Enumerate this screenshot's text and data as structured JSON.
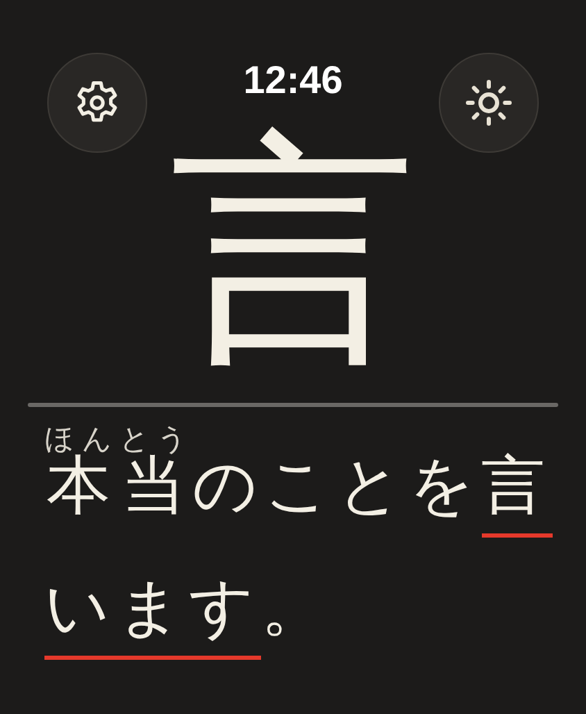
{
  "status_bar": {
    "time": "12:46"
  },
  "buttons": [
    {
      "kind": "settings"
    },
    {
      "kind": "brightness"
    }
  ],
  "kanji": "言",
  "sentence": [
    {
      "text": "本当",
      "ruby": "ほんとう",
      "highlighted": false
    },
    {
      "text": "のことを",
      "highlighted": false
    },
    {
      "text": "言います",
      "highlighted": true
    },
    {
      "text": "。",
      "highlighted": false
    }
  ]
}
